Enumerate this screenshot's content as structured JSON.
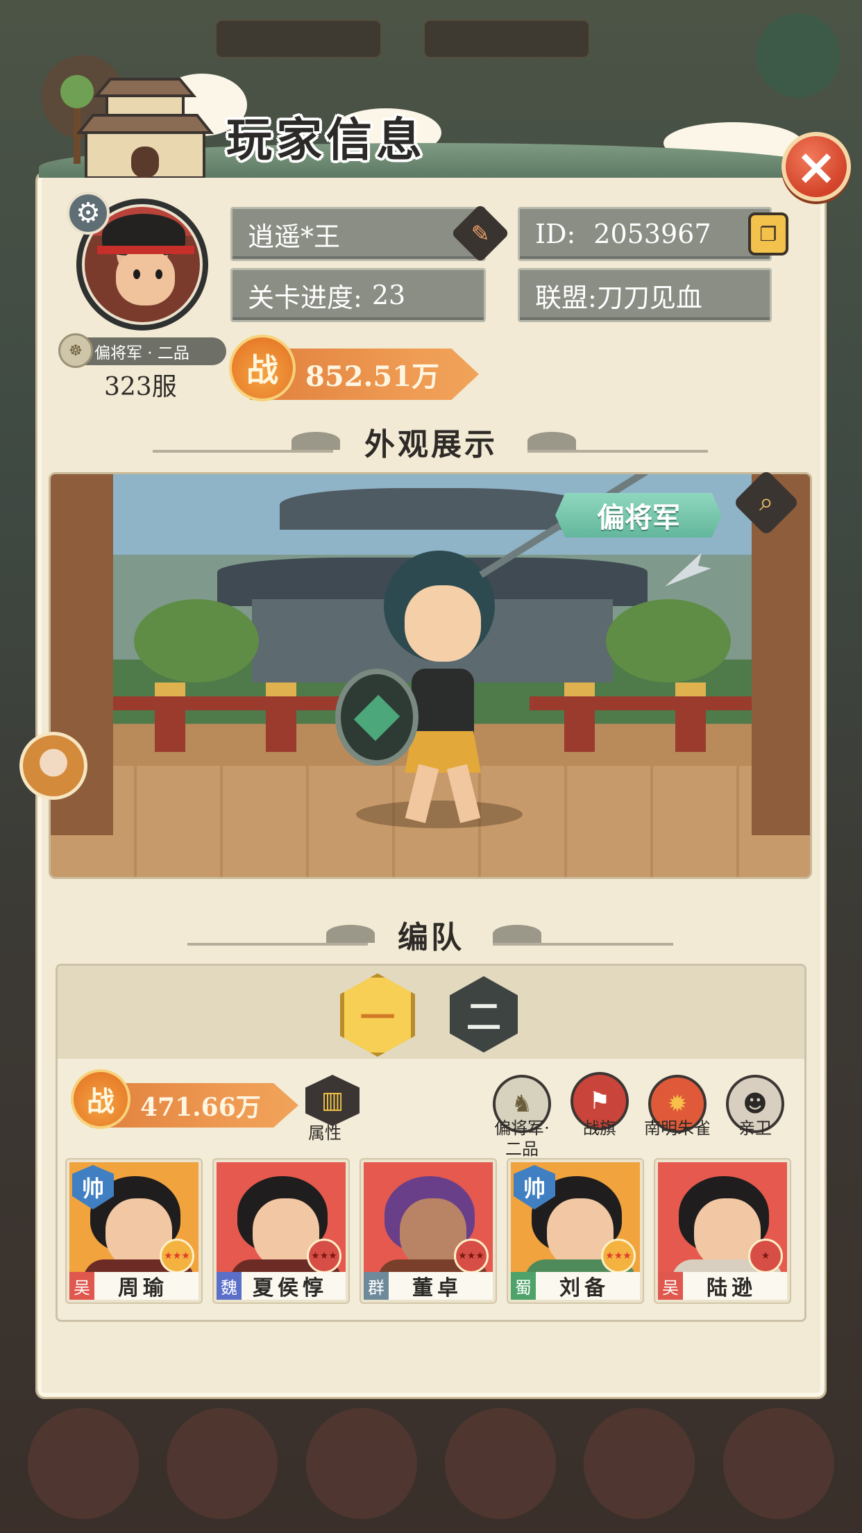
{
  "header": {
    "title": "玩家信息",
    "close_icon": "×"
  },
  "player": {
    "name": "逍遥*王",
    "id_label": "ID:",
    "id_value": "2053967",
    "stage_label": "关卡进度:",
    "stage_value": "23",
    "alliance_label": "联盟:",
    "alliance_value": "刀刀见血",
    "rank": "偏将军 · 二品",
    "server": "323服",
    "power_badge": "战",
    "power": "852.51万"
  },
  "display": {
    "heading": "外观展示",
    "rank_tag": "偏将军"
  },
  "formation": {
    "heading": "编队",
    "tabs": [
      "一",
      "二"
    ],
    "active_tab": 0,
    "power_badge": "战",
    "power": "471.66万",
    "attr_label": "属性",
    "slots": [
      {
        "label": "偏将军·\n二品",
        "icon": "general-rank-icon",
        "color": "#d7d2bd"
      },
      {
        "label": "战旗",
        "icon": "war-flag-icon",
        "color": "#c9443a"
      },
      {
        "label": "南明朱雀",
        "icon": "vermilion-bird-icon",
        "color": "#e05a3a"
      },
      {
        "label": "亲卫",
        "icon": "guard-icon",
        "color": "#d9cfc0"
      }
    ],
    "heroes": [
      {
        "faction": "吴",
        "faction_color": "#e0574e",
        "name": "周瑜",
        "leader": "帅",
        "card": "gold"
      },
      {
        "faction": "魏",
        "faction_color": "#5b6fc9",
        "name": "夏侯惇",
        "leader": "",
        "card": "red"
      },
      {
        "faction": "群",
        "faction_color": "#6e8a9a",
        "name": "董卓",
        "leader": "",
        "card": "red"
      },
      {
        "faction": "蜀",
        "faction_color": "#4fa36a",
        "name": "刘备",
        "leader": "帅",
        "card": "gold"
      },
      {
        "faction": "吴",
        "faction_color": "#e0574e",
        "name": "陆逊",
        "leader": "",
        "card": "red"
      }
    ]
  }
}
